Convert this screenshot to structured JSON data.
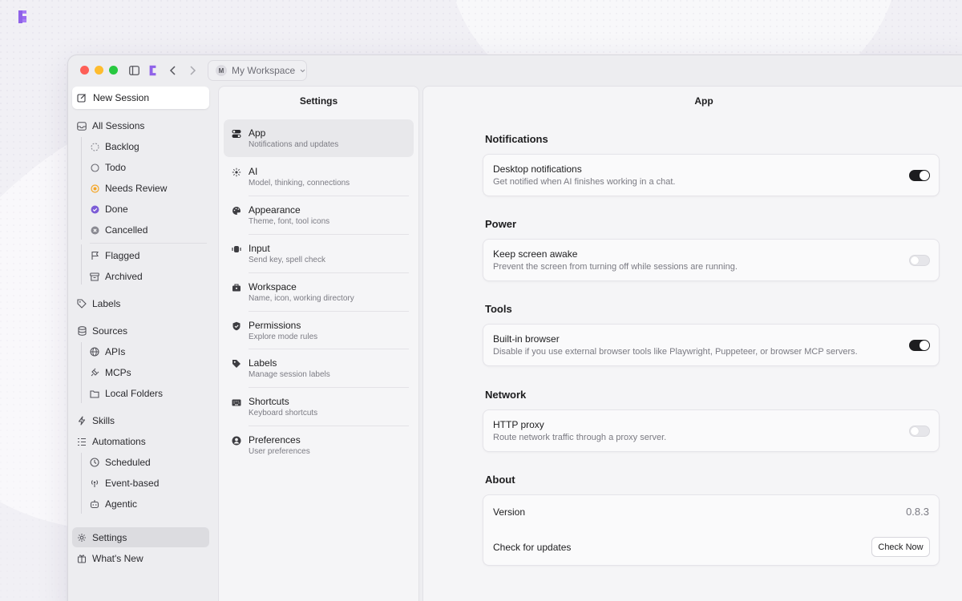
{
  "colors": {
    "accent": "#8b5cf6",
    "toggle_on": "#1d1d1f",
    "review": "#f5a524",
    "done": "#7c5cd6"
  },
  "titlebar": {
    "workspace_initial": "M",
    "workspace_name": "My Workspace"
  },
  "sidebar": {
    "new_session": "New Session",
    "all_sessions": "All Sessions",
    "statuses": [
      "Backlog",
      "Todo",
      "Needs Review",
      "Done",
      "Cancelled"
    ],
    "flagged": "Flagged",
    "archived": "Archived",
    "labels": "Labels",
    "sources": "Sources",
    "source_items": [
      "APIs",
      "MCPs",
      "Local Folders"
    ],
    "skills": "Skills",
    "automations": "Automations",
    "automation_items": [
      "Scheduled",
      "Event-based",
      "Agentic"
    ],
    "settings": "Settings",
    "whats_new": "What's New"
  },
  "settings_panel": {
    "title": "Settings",
    "items": [
      {
        "title": "App",
        "subtitle": "Notifications and updates",
        "icon": "toggle-icon"
      },
      {
        "title": "AI",
        "subtitle": "Model, thinking, connections",
        "icon": "sparkle-icon"
      },
      {
        "title": "Appearance",
        "subtitle": "Theme, font, tool icons",
        "icon": "palette-icon"
      },
      {
        "title": "Input",
        "subtitle": "Send key, spell check",
        "icon": "keyboard-input-icon"
      },
      {
        "title": "Workspace",
        "subtitle": "Name, icon, working directory",
        "icon": "briefcase-icon"
      },
      {
        "title": "Permissions",
        "subtitle": "Explore mode rules",
        "icon": "shield-icon"
      },
      {
        "title": "Labels",
        "subtitle": "Manage session labels",
        "icon": "tag-icon"
      },
      {
        "title": "Shortcuts",
        "subtitle": "Keyboard shortcuts",
        "icon": "keyboard-icon"
      },
      {
        "title": "Preferences",
        "subtitle": "User preferences",
        "icon": "user-icon"
      }
    ]
  },
  "main": {
    "title": "App",
    "notifications": {
      "heading": "Notifications",
      "title": "Desktop notifications",
      "subtitle": "Get notified when AI finishes working in a chat.",
      "enabled": true
    },
    "power": {
      "heading": "Power",
      "title": "Keep screen awake",
      "subtitle": "Prevent the screen from turning off while sessions are running.",
      "enabled": false
    },
    "tools": {
      "heading": "Tools",
      "title": "Built-in browser",
      "subtitle": "Disable if you use external browser tools like Playwright, Puppeteer, or browser MCP servers.",
      "enabled": true
    },
    "network": {
      "heading": "Network",
      "title": "HTTP proxy",
      "subtitle": "Route network traffic through a proxy server.",
      "enabled": false
    },
    "about": {
      "heading": "About",
      "version_label": "Version",
      "version_value": "0.8.3",
      "updates_label": "Check for updates",
      "check_button": "Check Now"
    }
  }
}
